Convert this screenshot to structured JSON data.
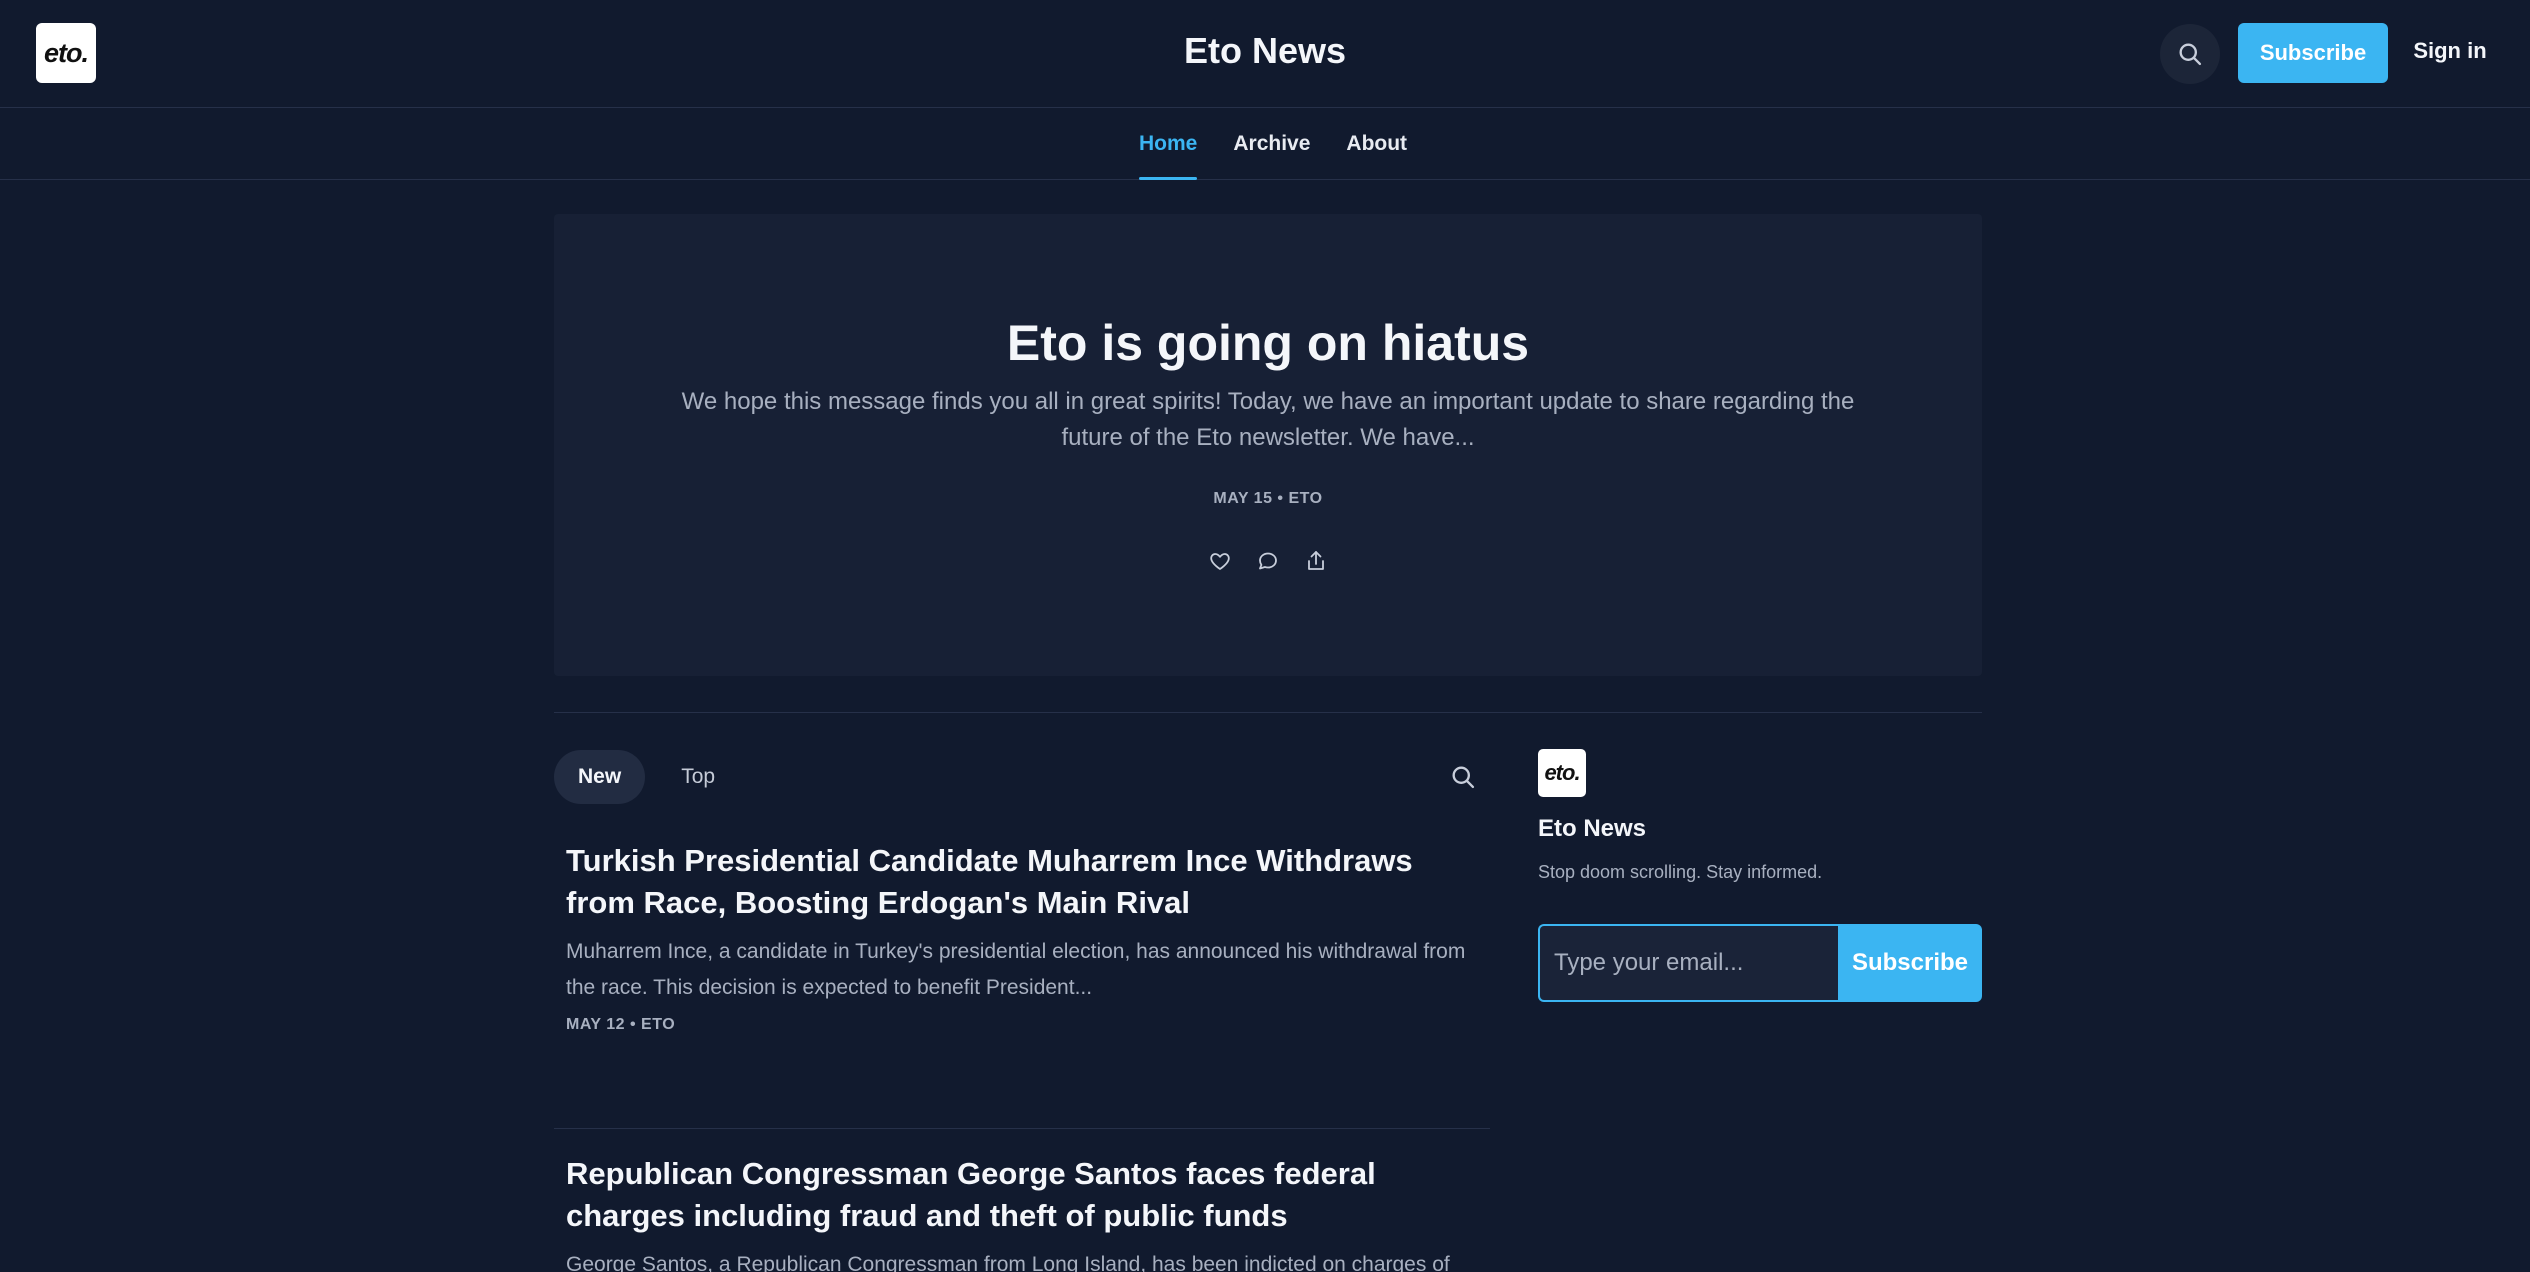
{
  "header": {
    "logo_text": "eto.",
    "site_title": "Eto News",
    "subscribe_label": "Subscribe",
    "signin_label": "Sign in"
  },
  "nav": {
    "items": [
      {
        "label": "Home",
        "active": true
      },
      {
        "label": "Archive",
        "active": false
      },
      {
        "label": "About",
        "active": false
      }
    ]
  },
  "hero": {
    "title": "Eto is going on hiatus",
    "description": "We hope this message finds you all in great spirits! Today, we have an important update to share regarding the future of the Eto newsletter. We have...",
    "meta": "MAY 15 • ETO",
    "actions": [
      "heart-icon",
      "comment-icon",
      "share-icon"
    ]
  },
  "feed": {
    "tabs": [
      {
        "label": "New",
        "active": true
      },
      {
        "label": "Top",
        "active": false
      }
    ],
    "posts": [
      {
        "title": "Turkish Presidential Candidate Muharrem Ince Withdraws from Race, Boosting Erdogan's Main Rival",
        "excerpt": "Muharrem Ince, a candidate in Turkey's presidential election, has announced his withdrawal from the race. This decision is expected to benefit President...",
        "meta": "MAY 12 • ETO"
      },
      {
        "title": "Republican Congressman George Santos faces federal charges including fraud and theft of public funds",
        "excerpt": "George Santos, a Republican Congressman from Long Island, has been indicted on charges of wire...",
        "meta": ""
      }
    ]
  },
  "sidebar": {
    "logo_text": "eto.",
    "title": "Eto News",
    "tagline": "Stop doom scrolling. Stay informed.",
    "email_placeholder": "Type your email...",
    "subscribe_label": "Subscribe"
  },
  "colors": {
    "background": "#111a2e",
    "card": "#172035",
    "accent": "#3bb5f2",
    "muted_text": "#a8b0c0"
  }
}
